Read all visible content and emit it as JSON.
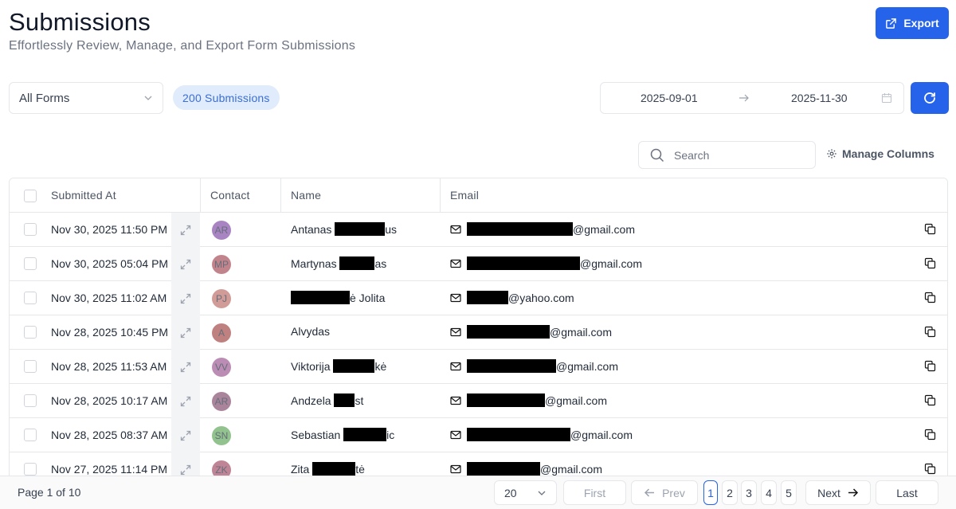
{
  "header": {
    "title": "Submissions",
    "subtitle": "Effortlessly Review, Manage, and Export Form Submissions",
    "export_label": "Export"
  },
  "filters": {
    "form_select_value": "All Forms",
    "count_badge": "200 Submissions",
    "date_from": "2025-09-01",
    "date_to": "2025-11-30"
  },
  "toolbar": {
    "search_placeholder": "Search",
    "manage_columns_label": "Manage Columns"
  },
  "table": {
    "columns": [
      "Submitted At",
      "Contact",
      "Name",
      "Email"
    ],
    "rows": [
      {
        "submitted_at": "Nov 30, 2025  11:50 PM",
        "initials": "AR",
        "avatar_color": "#9b6fb8",
        "name_pre": "Antanas ",
        "name_post": "us",
        "email_pre": "",
        "email_post": "@gmail.com"
      },
      {
        "submitted_at": "Nov 30, 2025  05:04 PM",
        "initials": "MP",
        "avatar_color": "#b86f78",
        "name_pre": "Martynas ",
        "name_post": "as",
        "email_pre": "",
        "email_post": "@gmail.com"
      },
      {
        "submitted_at": "Nov 30, 2025  11:02 AM",
        "initials": "PJ",
        "avatar_color": "#c98a86",
        "name_pre": "",
        "name_post": "ė Jolita",
        "email_pre": "",
        "email_post": "@yahoo.com"
      },
      {
        "submitted_at": "Nov 28, 2025  10:45 PM",
        "initials": "A",
        "avatar_color": "#b56b6b",
        "name_pre": "Alvydas",
        "name_post": "",
        "email_pre": "",
        "email_post": "@gmail.com"
      },
      {
        "submitted_at": "Nov 28, 2025  11:53 AM",
        "initials": "VV",
        "avatar_color": "#b07aa8",
        "name_pre": "Viktorija ",
        "name_post": "kė",
        "email_pre": "",
        "email_post": "@gmail.com"
      },
      {
        "submitted_at": "Nov 28, 2025  10:17 AM",
        "initials": "AR",
        "avatar_color": "#9b6f8a",
        "name_pre": "Andzela ",
        "name_post": "st",
        "email_pre": "",
        "email_post": "@gmail.com"
      },
      {
        "submitted_at": "Nov 28, 2025  08:37 AM",
        "initials": "SN",
        "avatar_color": "#7fb87a",
        "name_pre": "Sebastian ",
        "name_post": "ic",
        "email_pre": "",
        "email_post": "@gmail.com"
      },
      {
        "submitted_at": "Nov 27, 2025  11:14 PM",
        "initials": "ZK",
        "avatar_color": "#b56f84",
        "name_pre": "Zita ",
        "name_post": "tė",
        "email_pre": "",
        "email_post": "@gmail.com"
      }
    ]
  },
  "pagination": {
    "page_info": "Page 1 of 10",
    "page_size": "20",
    "first_label": "First",
    "prev_label": "Prev",
    "pages": [
      "1",
      "2",
      "3",
      "4",
      "5"
    ],
    "current_page": "1",
    "next_label": "Next",
    "last_label": "Last"
  },
  "colors": {
    "accent": "#2563eb",
    "badge_bg": "#e0ebfb",
    "badge_text": "#3b6fd4"
  }
}
